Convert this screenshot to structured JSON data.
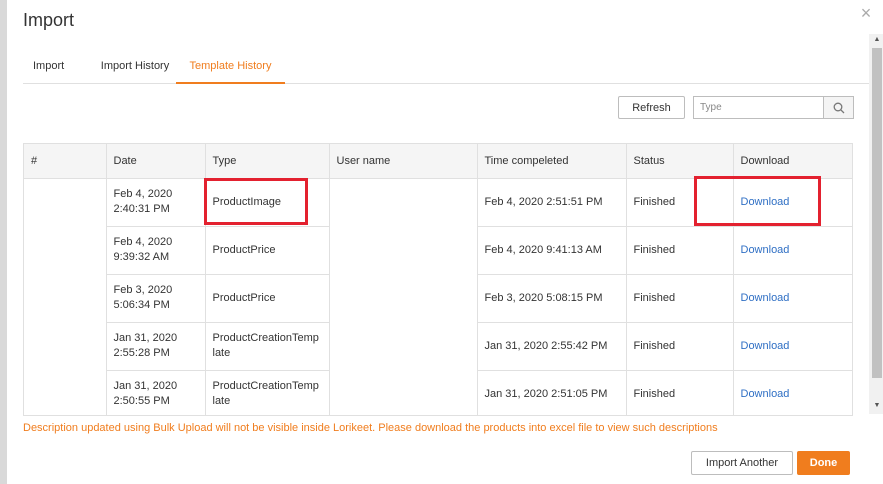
{
  "dialog": {
    "title": "Import",
    "close_symbol": "×"
  },
  "tabs": [
    {
      "label": "Import",
      "active": false
    },
    {
      "label": "Import History",
      "active": false
    },
    {
      "label": "Template History",
      "active": true
    }
  ],
  "toolbar": {
    "refresh_label": "Refresh",
    "search_placeholder": "Type"
  },
  "table": {
    "headers": [
      "#",
      "Date",
      "Type",
      "User name",
      "Time compeleted",
      "Status",
      "Download"
    ],
    "rows": [
      {
        "date_line1": "Feb 4, 2020",
        "date_line2": "2:40:31 PM",
        "type": "ProductImage",
        "type_line2": "",
        "time_completed": "Feb 4, 2020 2:51:51 PM",
        "status": "Finished",
        "download": "Download"
      },
      {
        "date_line1": "Feb 4, 2020",
        "date_line2": "9:39:32 AM",
        "type": "ProductPrice",
        "type_line2": "",
        "time_completed": "Feb 4, 2020 9:41:13 AM",
        "status": "Finished",
        "download": "Download"
      },
      {
        "date_line1": "Feb 3, 2020",
        "date_line2": "5:06:34 PM",
        "type": "ProductPrice",
        "type_line2": "",
        "time_completed": "Feb 3, 2020 5:08:15 PM",
        "status": "Finished",
        "download": "Download"
      },
      {
        "date_line1": "Jan 31, 2020",
        "date_line2": "2:55:28 PM",
        "type": "ProductCreationTemp",
        "type_line2": "late",
        "time_completed": "Jan 31, 2020 2:55:42 PM",
        "status": "Finished",
        "download": "Download"
      },
      {
        "date_line1": "Jan 31, 2020",
        "date_line2": "2:50:55 PM",
        "type": "ProductCreationTemp",
        "type_line2": "late",
        "time_completed": "Jan 31, 2020 2:51:05 PM",
        "status": "Finished",
        "download": "Download"
      }
    ]
  },
  "warning": "Description updated using Bulk Upload will not be visible inside Lorikeet. Please download the products into excel file to view such descriptions",
  "footer": {
    "import_another_label": "Import Another",
    "done_label": "Done"
  },
  "colors": {
    "accent": "#f07d1e",
    "link": "#2f6fc4",
    "highlight": "#e3212f"
  },
  "icons": {
    "search": "search-icon",
    "close": "close-icon"
  }
}
